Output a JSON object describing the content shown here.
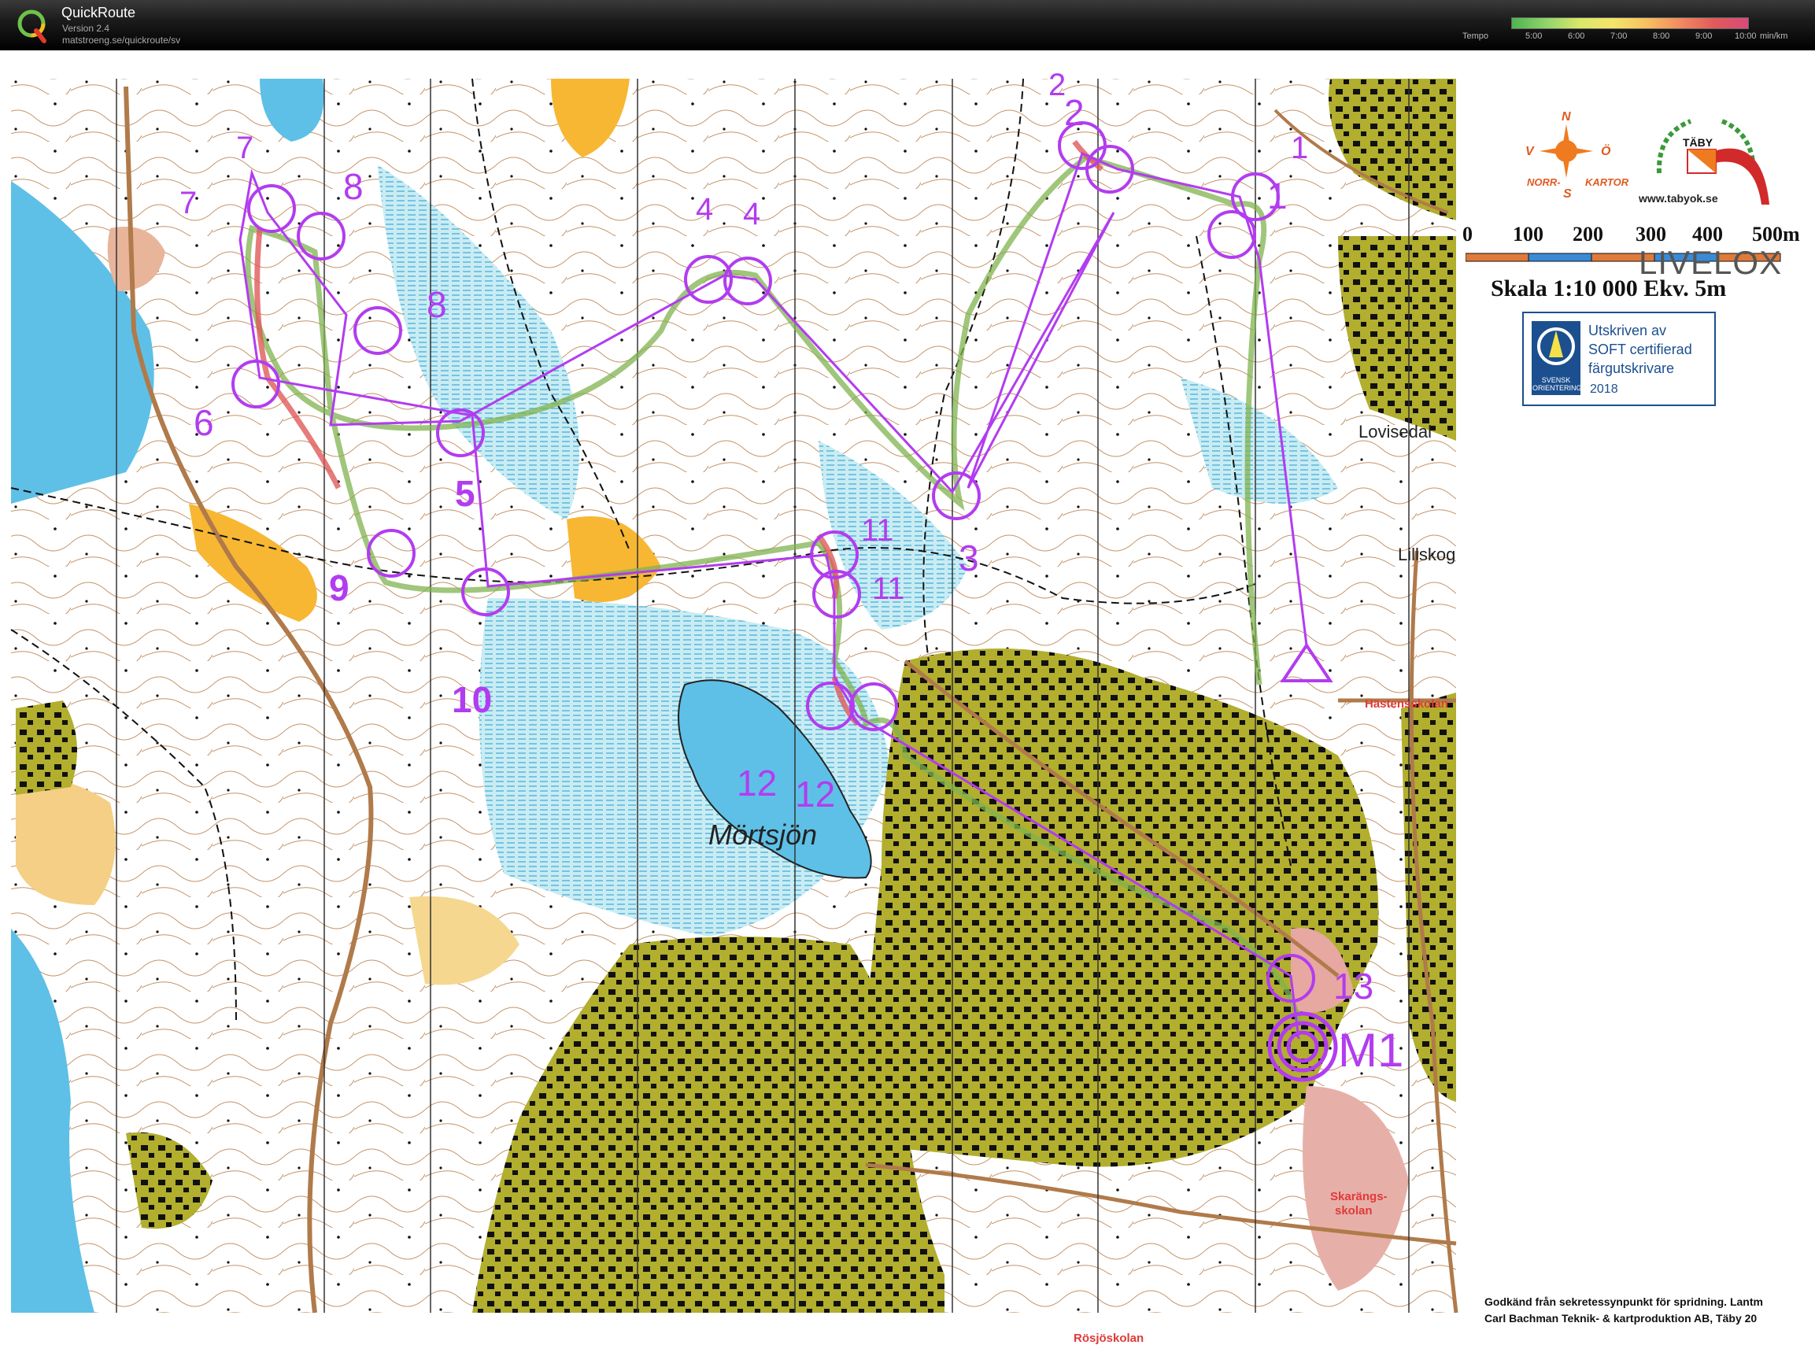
{
  "app": {
    "title": "QuickRoute",
    "version": "Version 2.4",
    "url": "matstroeng.se/quickroute/sv",
    "logo_letter": "Q"
  },
  "tempo_legend": {
    "label": "Tempo",
    "ticks": [
      "5:00",
      "6:00",
      "7:00",
      "8:00",
      "9:00",
      "10:00"
    ],
    "unit": "min/km"
  },
  "map": {
    "lake_name": "Mörtsjön",
    "places": [
      "Lovisedal",
      "Lillskog"
    ],
    "red_places": [
      "Hästensskolan",
      "Skarängs-",
      "skolan",
      "Rösjöskolan"
    ],
    "controls": [
      {
        "id": "1",
        "labels": [
          "1",
          "1"
        ]
      },
      {
        "id": "2",
        "labels": [
          "2",
          "2"
        ]
      },
      {
        "id": "3",
        "labels": [
          "3"
        ]
      },
      {
        "id": "4",
        "labels": [
          "4",
          "4"
        ]
      },
      {
        "id": "5",
        "labels": [
          "5"
        ]
      },
      {
        "id": "6",
        "labels": [
          "6"
        ]
      },
      {
        "id": "7",
        "labels": [
          "7",
          "7"
        ]
      },
      {
        "id": "8",
        "labels": [
          "8",
          "8"
        ]
      },
      {
        "id": "9",
        "labels": [
          "9"
        ]
      },
      {
        "id": "10",
        "labels": [
          "10"
        ]
      },
      {
        "id": "11",
        "labels": [
          "11",
          "11"
        ]
      },
      {
        "id": "12",
        "labels": [
          "12",
          "12"
        ]
      },
      {
        "id": "13",
        "labels": [
          "13"
        ]
      },
      {
        "id": "M1",
        "labels": [
          "M1"
        ]
      }
    ],
    "colors": {
      "course": "#b23cf0",
      "forest": "#ffffff",
      "open": "#f7b733",
      "urban": "#a9a623",
      "water": "#69c6e6",
      "marsh": "#bfe6ef",
      "contour": "#b07a4a"
    }
  },
  "legend": {
    "compass": {
      "n": "N",
      "s": "S",
      "v": "V",
      "o": "Ö",
      "left_text": "NORR-",
      "right_text": "KARTOR"
    },
    "club": {
      "name": "TÄBY",
      "url": "www.tabyok.se"
    },
    "scale_numbers": [
      "0",
      "100",
      "200",
      "300",
      "400",
      "500m"
    ],
    "scale_text": "Skala 1:10 000  Ekv. 5m",
    "watermark": "LIVELOX",
    "soft": {
      "badge": "SVENSK ORIENTERING",
      "line1": "Utskriven av",
      "line2": "SOFT certifierad",
      "line3": "färgutskrivare",
      "year": "2018"
    },
    "footer": [
      "Godkänd från sekretessynpunkt  för spridning. Lantm",
      "Carl Bachman Teknik- & kartproduktion AB, Täby 20"
    ]
  }
}
